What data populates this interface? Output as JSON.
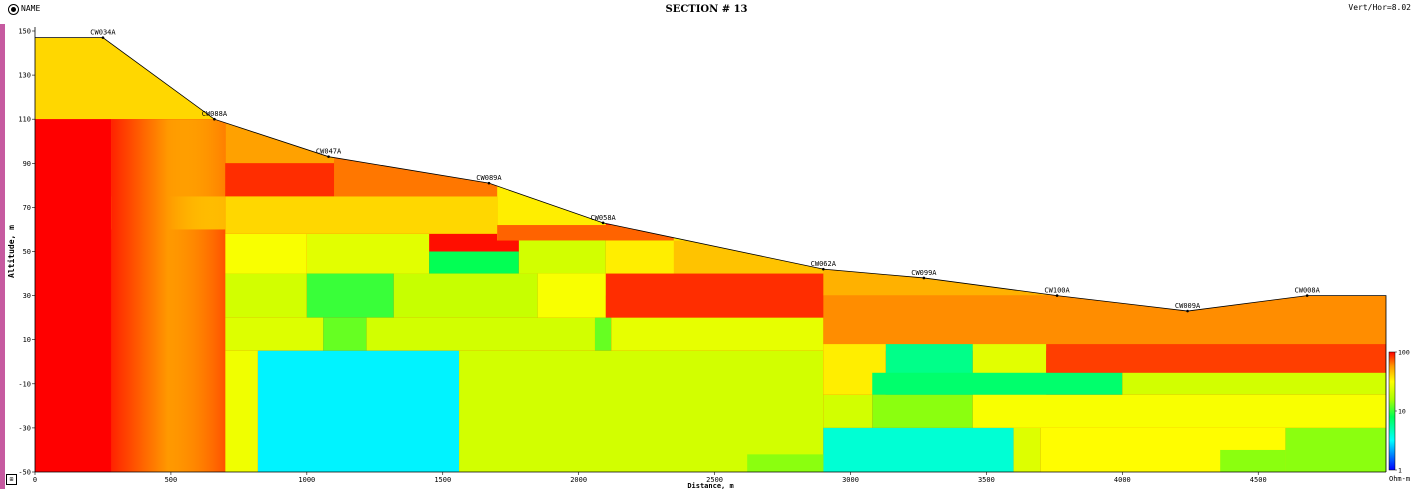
{
  "header": {
    "radio_label": "NAME",
    "title": "SECTION # 13",
    "ratio": "Vert/Hor=8.02"
  },
  "chart_data": {
    "type": "heatmap",
    "title": "SECTION # 13",
    "xlabel": "Distance, m",
    "ylabel": "Altitude, m",
    "xlim": [
      0,
      4970
    ],
    "ylim": [
      -50,
      150
    ],
    "xticks": [
      0,
      500,
      1000,
      1500,
      2000,
      2500,
      3000,
      3500,
      4000,
      4500
    ],
    "yticks": [
      -50,
      -30,
      -10,
      10,
      30,
      50,
      70,
      90,
      110,
      130,
      150
    ],
    "colorbar": {
      "scale": "log",
      "min": 1,
      "max": 100,
      "labels": [
        {
          "value": 100,
          "text": "100"
        },
        {
          "value": 10,
          "text": "10"
        },
        {
          "value": 1,
          "text": "1"
        }
      ],
      "unit": "Ohm-m"
    },
    "stations": [
      {
        "name": "CW034A",
        "x": 250,
        "z": 147
      },
      {
        "name": "CW088A",
        "x": 660,
        "z": 110
      },
      {
        "name": "CW047A",
        "x": 1080,
        "z": 93
      },
      {
        "name": "CW089A",
        "x": 1670,
        "z": 81
      },
      {
        "name": "CW058A",
        "x": 2090,
        "z": 63
      },
      {
        "name": "CW062A",
        "x": 2900,
        "z": 42
      },
      {
        "name": "CW099A",
        "x": 3270,
        "z": 38
      },
      {
        "name": "CW100A",
        "x": 3760,
        "z": 30
      },
      {
        "name": "CW009A",
        "x": 4240,
        "z": 23
      },
      {
        "name": "CW008A",
        "x": 4680,
        "z": 30
      }
    ],
    "surface": [
      [
        0,
        147
      ],
      [
        250,
        147
      ],
      [
        660,
        110
      ],
      [
        1080,
        93
      ],
      [
        1670,
        81
      ],
      [
        2090,
        63
      ],
      [
        2900,
        42
      ],
      [
        3270,
        38
      ],
      [
        3760,
        30
      ],
      [
        4240,
        23
      ],
      [
        4680,
        30
      ],
      [
        4970,
        30
      ]
    ],
    "blocks": [
      {
        "x0": 0,
        "x1": 4970,
        "y0": -50,
        "y1": 150,
        "r": 95
      },
      {
        "x0": 0,
        "x1": 700,
        "y0": 110,
        "y1": 150,
        "r": 40
      },
      {
        "x0": 700,
        "x1": 1100,
        "y0": 90,
        "y1": 150,
        "r": 55
      },
      {
        "x0": 1100,
        "x1": 1700,
        "y0": 75,
        "y1": 150,
        "r": 65
      },
      {
        "x0": 1700,
        "x1": 2100,
        "y0": 55,
        "y1": 150,
        "r": 35
      },
      {
        "x0": 2100,
        "x1": 2900,
        "y0": 30,
        "y1": 60,
        "r": 35
      },
      {
        "x0": 2900,
        "x1": 4970,
        "y0": 30,
        "y1": 45,
        "r": 50
      },
      {
        "x0": 1700,
        "x1": 2350,
        "y0": 55,
        "y1": 62,
        "r": 70
      },
      {
        "x0": 2350,
        "x1": 2900,
        "y0": 40,
        "y1": 55,
        "r": 45
      },
      {
        "x0": 250,
        "x1": 700,
        "y0": 75,
        "y1": 110,
        "r": 75
      },
      {
        "x0": 700,
        "x1": 1100,
        "y0": 75,
        "y1": 90,
        "r": 85
      },
      {
        "x0": 250,
        "x1": 700,
        "y0": 60,
        "y1": 75,
        "r": 55
      },
      {
        "x0": 700,
        "x1": 1700,
        "y0": 58,
        "y1": 75,
        "r": 40
      },
      {
        "x0": 700,
        "x1": 1000,
        "y0": 40,
        "y1": 58,
        "r": 30
      },
      {
        "x0": 1000,
        "x1": 1450,
        "y0": 40,
        "y1": 58,
        "r": 25
      },
      {
        "x0": 1450,
        "x1": 1780,
        "y0": 40,
        "y1": 50,
        "r": 8
      },
      {
        "x0": 1780,
        "x1": 2100,
        "y0": 40,
        "y1": 55,
        "r": 22
      },
      {
        "x0": 700,
        "x1": 1000,
        "y0": 20,
        "y1": 40,
        "r": 22
      },
      {
        "x0": 1000,
        "x1": 1320,
        "y0": 20,
        "y1": 40,
        "r": 10
      },
      {
        "x0": 1320,
        "x1": 1850,
        "y0": 20,
        "y1": 40,
        "r": 20
      },
      {
        "x0": 1850,
        "x1": 2100,
        "y0": 20,
        "y1": 40,
        "r": 30
      },
      {
        "x0": 2100,
        "x1": 2900,
        "y0": 20,
        "y1": 40,
        "r": 85
      },
      {
        "x0": 2900,
        "x1": 4970,
        "y0": 5,
        "y1": 30,
        "r": 60
      },
      {
        "x0": 700,
        "x1": 1060,
        "y0": 5,
        "y1": 20,
        "r": 24
      },
      {
        "x0": 1060,
        "x1": 1220,
        "y0": 5,
        "y1": 20,
        "r": 12
      },
      {
        "x0": 1220,
        "x1": 2060,
        "y0": 5,
        "y1": 20,
        "r": 22
      },
      {
        "x0": 2060,
        "x1": 2120,
        "y0": 5,
        "y1": 20,
        "r": 12
      },
      {
        "x0": 2120,
        "x1": 2900,
        "y0": 5,
        "y1": 20,
        "r": 26
      },
      {
        "x0": 700,
        "x1": 820,
        "y0": -50,
        "y1": 5,
        "r": 28
      },
      {
        "x0": 820,
        "x1": 1560,
        "y0": -50,
        "y1": 5,
        "r": 3
      },
      {
        "x0": 1560,
        "x1": 2900,
        "y0": -50,
        "y1": 5,
        "r": 22
      },
      {
        "x0": 2900,
        "x1": 3130,
        "y0": -15,
        "y1": 8,
        "r": 35
      },
      {
        "x0": 3130,
        "x1": 3450,
        "y0": -15,
        "y1": 8,
        "r": 6
      },
      {
        "x0": 3450,
        "x1": 3720,
        "y0": -15,
        "y1": 8,
        "r": 25
      },
      {
        "x0": 3720,
        "x1": 4970,
        "y0": -5,
        "y1": 8,
        "r": 80
      },
      {
        "x0": 3080,
        "x1": 4000,
        "y0": -15,
        "y1": -5,
        "r": 7
      },
      {
        "x0": 4000,
        "x1": 4970,
        "y0": -15,
        "y1": -5,
        "r": 22
      },
      {
        "x0": 2900,
        "x1": 3080,
        "y0": -30,
        "y1": -15,
        "r": 22
      },
      {
        "x0": 3080,
        "x1": 3450,
        "y0": -30,
        "y1": -15,
        "r": 14
      },
      {
        "x0": 3450,
        "x1": 4970,
        "y0": -30,
        "y1": -15,
        "r": 30
      },
      {
        "x0": 2900,
        "x1": 3600,
        "y0": -50,
        "y1": -30,
        "r": 4
      },
      {
        "x0": 3600,
        "x1": 3700,
        "y0": -50,
        "y1": -30,
        "r": 24
      },
      {
        "x0": 3700,
        "x1": 4600,
        "y0": -50,
        "y1": -30,
        "r": 32
      },
      {
        "x0": 4600,
        "x1": 4970,
        "y0": -50,
        "y1": -30,
        "r": 14
      },
      {
        "x0": 2620,
        "x1": 2900,
        "y0": -50,
        "y1": -42,
        "r": 14
      },
      {
        "x0": 4360,
        "x1": 4600,
        "y0": -50,
        "y1": -40,
        "r": 14
      }
    ]
  }
}
